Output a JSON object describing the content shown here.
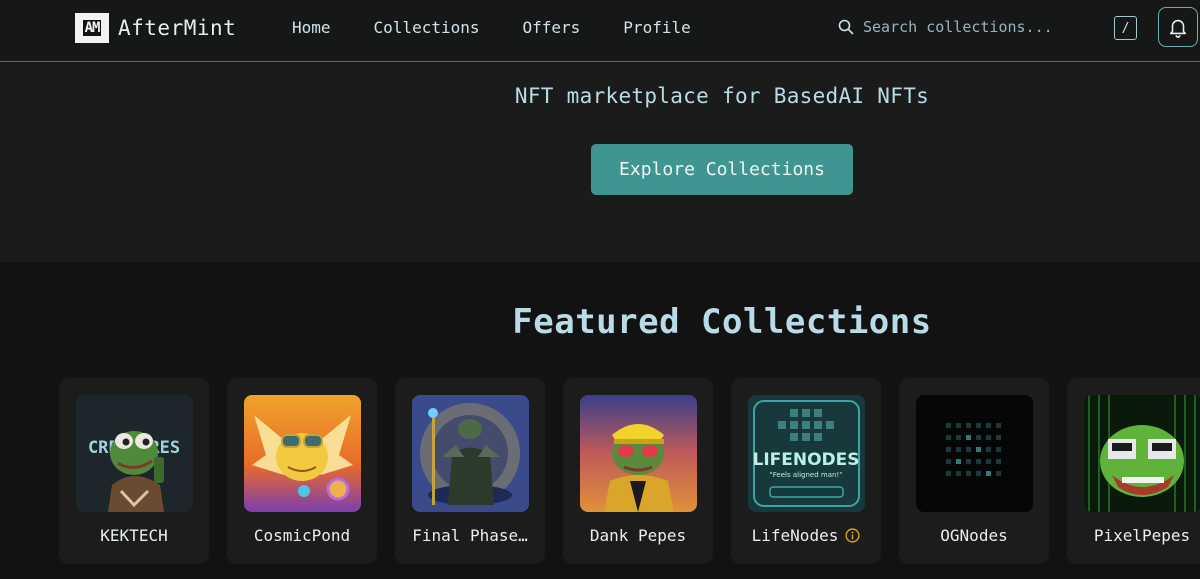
{
  "header": {
    "logo_mark": "AM",
    "app_name": "AfterMint",
    "nav": [
      "Home",
      "Collections",
      "Offers",
      "Profile"
    ],
    "search_placeholder": "Search collections...",
    "search_shortcut": "/"
  },
  "hero": {
    "tagline": "NFT marketplace for BasedAI NFTs",
    "cta_label": "Explore Collections"
  },
  "featured": {
    "title": "Featured Collections",
    "collections": [
      {
        "name": "KEKTECH"
      },
      {
        "name": "CosmicPond"
      },
      {
        "name": "Final Phase…"
      },
      {
        "name": "Dank Pepes"
      },
      {
        "name": "LifeNodes",
        "badge": "info-icon"
      },
      {
        "name": "OGNodes"
      },
      {
        "name": "PixelPepes"
      }
    ],
    "lifenodes_art": {
      "title": "LIFENODES",
      "subtitle": "\"Feels aligned man!\""
    },
    "kektech_art": "CREATURES"
  },
  "colors": {
    "accent": "#3f9690",
    "header_border": "#3e7f7b",
    "text": "#cfe3ea",
    "background": "#121212"
  }
}
